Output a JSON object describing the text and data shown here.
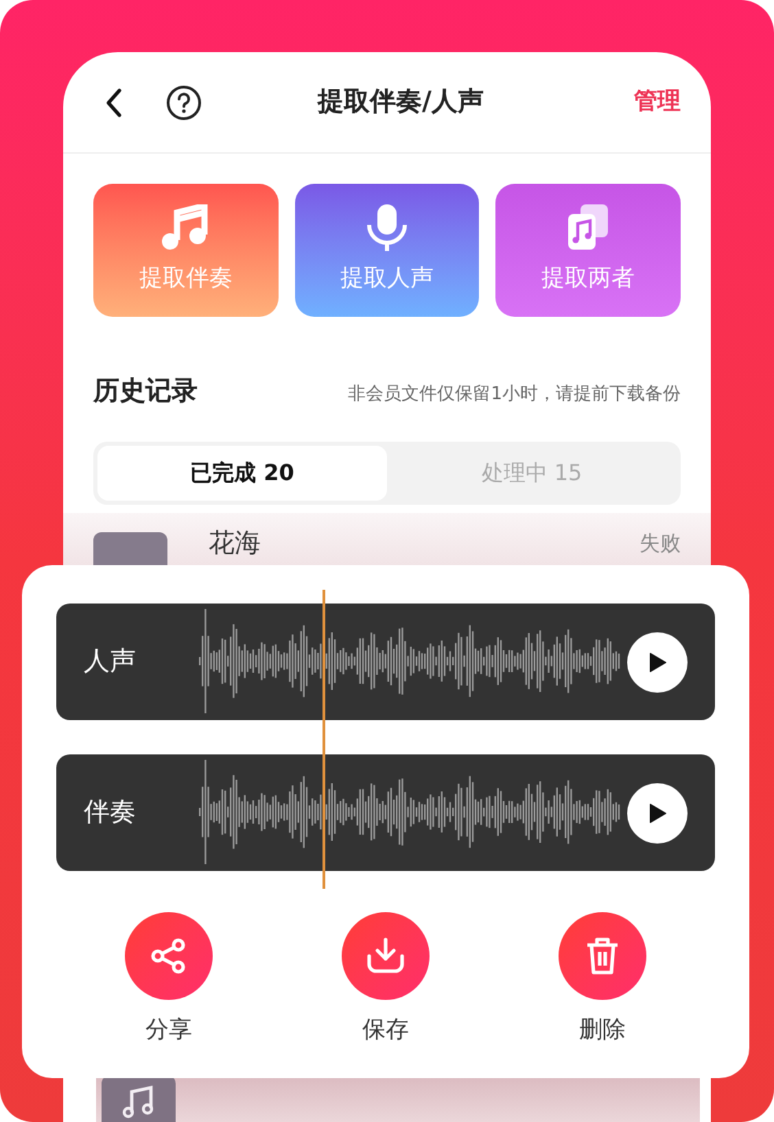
{
  "header": {
    "title": "提取伴奏/人声",
    "action": "管理"
  },
  "tools": [
    {
      "label": "提取伴奏",
      "kind": "accompaniment"
    },
    {
      "label": "提取人声",
      "kind": "vocal"
    },
    {
      "label": "提取两者",
      "kind": "both"
    }
  ],
  "history": {
    "title": "历史记录",
    "notice": "非会员文件仅保留1小时，请提前下载备份",
    "tabs": [
      {
        "label": "已完成 20",
        "selected": true
      },
      {
        "label": "处理中 15",
        "selected": false
      }
    ],
    "items": [
      {
        "title": "花海",
        "status": "失败"
      }
    ]
  },
  "player": {
    "tracks": [
      {
        "label": "人声"
      },
      {
        "label": "伴奏"
      }
    ],
    "actions": [
      {
        "label": "分享",
        "kind": "share"
      },
      {
        "label": "保存",
        "kind": "save"
      },
      {
        "label": "删除",
        "kind": "delete"
      }
    ]
  }
}
